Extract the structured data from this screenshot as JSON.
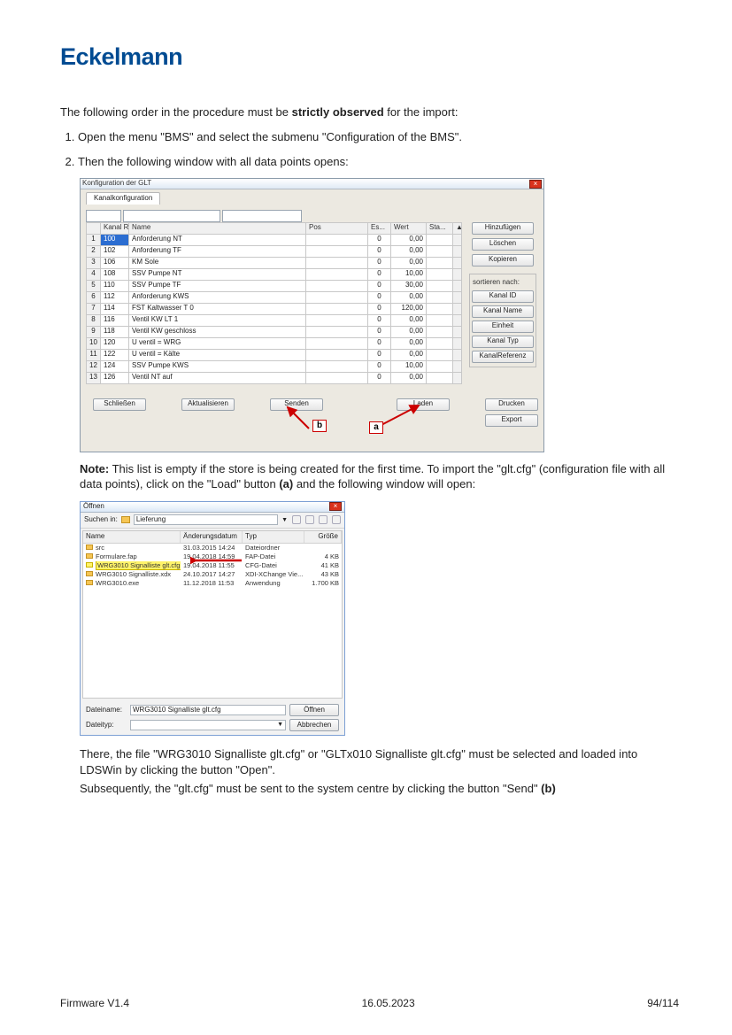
{
  "brand": "Eckelmann",
  "intro_pre": "The following order in the procedure must be ",
  "intro_strong": "strictly observed",
  "intro_post": " for the import:",
  "step1": "Open the menu \"BMS\" and select the submenu \"Configuration of the BMS\".",
  "step2": "Then the following window with all data points opens:",
  "win1": {
    "title": "Konfiguration der GLT",
    "tab": "Kanalkonfiguration",
    "headers": {
      "idx": "",
      "ref": "Kanal Referenz",
      "name": "Name",
      "pos": "Pos",
      "es": "Es...",
      "wert": "Wert",
      "sta": "Sta..."
    },
    "rows": [
      {
        "idx": "1",
        "ref": "100",
        "name": "Anforderung NT",
        "es": "0",
        "wert": "0,00"
      },
      {
        "idx": "2",
        "ref": "102",
        "name": "Anforderung TF",
        "es": "0",
        "wert": "0,00"
      },
      {
        "idx": "3",
        "ref": "106",
        "name": "KM Sole",
        "es": "0",
        "wert": "0,00"
      },
      {
        "idx": "4",
        "ref": "108",
        "name": "SSV Pumpe NT",
        "es": "0",
        "wert": "10,00"
      },
      {
        "idx": "5",
        "ref": "110",
        "name": "SSV Pumpe TF",
        "es": "0",
        "wert": "30,00"
      },
      {
        "idx": "6",
        "ref": "112",
        "name": "Anforderung KWS",
        "es": "0",
        "wert": "0,00"
      },
      {
        "idx": "7",
        "ref": "114",
        "name": "FST Kaltwasser T 0",
        "es": "0",
        "wert": "120,00"
      },
      {
        "idx": "8",
        "ref": "116",
        "name": "Ventil KW LT 1",
        "es": "0",
        "wert": "0,00"
      },
      {
        "idx": "9",
        "ref": "118",
        "name": "Ventil KW geschloss",
        "es": "0",
        "wert": "0,00"
      },
      {
        "idx": "10",
        "ref": "120",
        "name": "U ventil = WRG",
        "es": "0",
        "wert": "0,00"
      },
      {
        "idx": "11",
        "ref": "122",
        "name": "U ventil = Kälte",
        "es": "0",
        "wert": "0,00"
      },
      {
        "idx": "12",
        "ref": "124",
        "name": "SSV Pumpe KWS",
        "es": "0",
        "wert": "10,00"
      },
      {
        "idx": "13",
        "ref": "126",
        "name": "Ventil NT auf",
        "es": "0",
        "wert": "0,00"
      }
    ],
    "btn_hinzu": "Hinzufügen",
    "btn_loeschen": "Löschen",
    "btn_kopieren": "Kopieren",
    "sort_label": "sortieren nach:",
    "btn_kanalid": "Kanal ID",
    "btn_kanalname": "Kanal Name",
    "btn_einheit": "Einheit",
    "btn_kanaltyp": "Kanal Typ",
    "btn_kanalreferenz": "KanalReferenz",
    "btn_schliessen": "Schließen",
    "btn_akt": "Aktualisieren",
    "btn_senden": "Senden",
    "btn_laden": "Laden",
    "btn_drucken": "Drucken",
    "btn_export": "Export",
    "callout_a": "a",
    "callout_b": "b"
  },
  "note_label": "Note:",
  "note_body": " This list is empty if the store is being created for the first time. To import the \"glt.cfg\" (configuration file with all data points), click on the \"Load\" button ",
  "note_a": "(a)",
  "note_post": " and the following window will open:",
  "win2": {
    "title": "Öffnen",
    "suchen": "Suchen in:",
    "folder": "Lieferung",
    "cols": {
      "name": "Name",
      "date": "Änderungsdatum",
      "typ": "Typ",
      "size": "Größe"
    },
    "files": [
      {
        "name": "src",
        "date": "31.03.2015 14:24",
        "typ": "Dateiordner",
        "size": ""
      },
      {
        "name": "Formulare.fap",
        "date": "19.04.2018 14:59",
        "typ": "FAP-Datei",
        "size": "4 KB"
      },
      {
        "name": "WRG3010 Signalliste glt.cfg",
        "date": "19.04.2018 11:55",
        "typ": "CFG-Datei",
        "size": "41 KB",
        "sel": true
      },
      {
        "name": "WRG3010 Signalliste.xdx",
        "date": "24.10.2017 14:27",
        "typ": "XDI-XChange Vie...",
        "size": "43 KB"
      },
      {
        "name": "WRG3010.exe",
        "date": "11.12.2018 11:53",
        "typ": "Anwendung",
        "size": "1.700 KB"
      }
    ],
    "filename_label": "Dateiname:",
    "filename_value": "WRG3010 Signalliste glt.cfg",
    "filetype_label": "Dateityp:",
    "filetype_value": "",
    "btn_open": "Öffnen",
    "btn_cancel": "Abbrechen"
  },
  "after1": "There, the file \"WRG3010 Signalliste glt.cfg\" or \"GLTx010 Signalliste glt.cfg\" must be selected and loaded into LDSWin by clicking the button \"Open\".",
  "after2_pre": "Subsequently, the \"glt.cfg\" must be sent to the system centre by clicking the button \"Send\" ",
  "after2_b": "(b)",
  "footer": {
    "left": "Firmware V1.4",
    "center": "16.05.2023",
    "right": "94/114"
  }
}
